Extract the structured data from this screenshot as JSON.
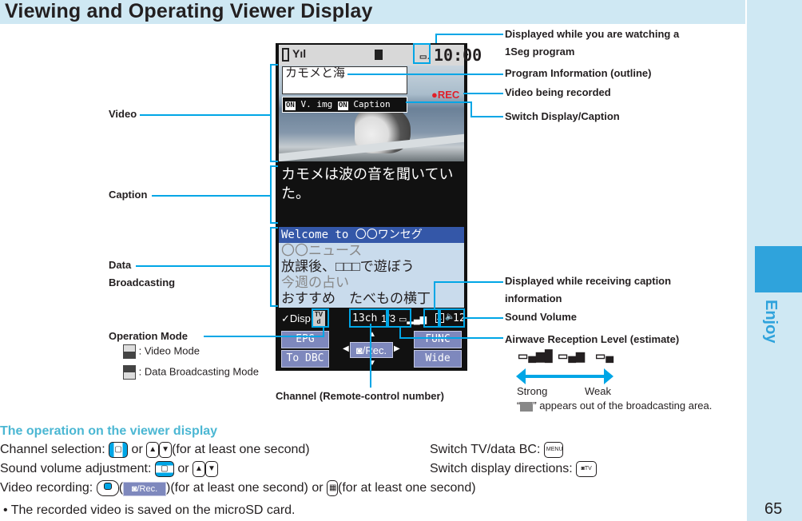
{
  "page": {
    "title": "Viewing and Operating Viewer Display",
    "side_tab_label": "Enjoy",
    "page_number": "65"
  },
  "colors": {
    "accent": "#00a6e6",
    "tab_bg": "#cfe8f3",
    "tab_block": "#2fa3dc",
    "heading": "#4bb7d3",
    "softkey": "#7e88bd",
    "rec": "#e0202a"
  },
  "phone": {
    "clock": "10:00",
    "status_icons": [
      "battery-icon",
      "signal-antenna-icon",
      "microsd-icon",
      "1seg-icon"
    ],
    "program_title": "カモメと海",
    "rec_label": "●REC",
    "switch_bar": {
      "on1": "ON",
      "label1": "V. img",
      "on2": "ON",
      "label2": "Caption"
    },
    "caption_text": "カモメは波の音を聞いていた。",
    "data_broadcast_lines": [
      "Welcome to 〇〇ワンセグ",
      "〇〇ニュース",
      "放課後、□□□で遊ぼう",
      "今週の占い",
      "おすすめ　たべもの横丁"
    ],
    "info_bar": {
      "disp": "Disp",
      "mode_icon": "TV/d",
      "channel": "13ch",
      "fraction": "1/3",
      "volume": "12"
    },
    "softkeys": {
      "top_left": "EPG",
      "bottom_left": "To DBC",
      "center": "/Rec.",
      "top_right": "FUNC",
      "bottom_right": "Wide"
    }
  },
  "callouts": {
    "left": {
      "video": "Video",
      "caption": "Caption",
      "data_broadcasting_1": "Data",
      "data_broadcasting_2": "Broadcasting",
      "operation_mode": "Operation Mode",
      "video_mode": ": Video Mode",
      "data_mode": ": Data Broadcasting Mode"
    },
    "right": {
      "watching_1": "Displayed while you are watching a",
      "watching_2": "1Seg program",
      "program_info": "Program Information (outline)",
      "recording": "Video being recorded",
      "switch_display": "Switch Display/Caption",
      "caption_info_1": "Displayed while receiving caption",
      "caption_info_2": "information",
      "sound_volume": "Sound Volume",
      "airwave": "Airwave Reception Level (estimate)",
      "strong": "Strong",
      "weak": "Weak",
      "out_of_area": "” appears out of the broadcasting area."
    },
    "bottom": {
      "channel": "Channel (Remote-control number)"
    }
  },
  "operations": {
    "heading": "The operation on the viewer display",
    "channel_selection": "Channel selection:",
    "or": "or",
    "channel_suffix": "(for at least one second)",
    "volume_adjust": "Sound volume adjustment:",
    "video_recording": "Video recording:",
    "rec_suffix": ")(for at least one second) or",
    "rec_suffix2": "(for at least one second)",
    "switch_tv": "Switch TV/data BC:",
    "switch_dir": "Switch display directions:",
    "menu_key": "MENU",
    "tv_key": "TV",
    "note": "• The recorded video is saved on the microSD card."
  }
}
